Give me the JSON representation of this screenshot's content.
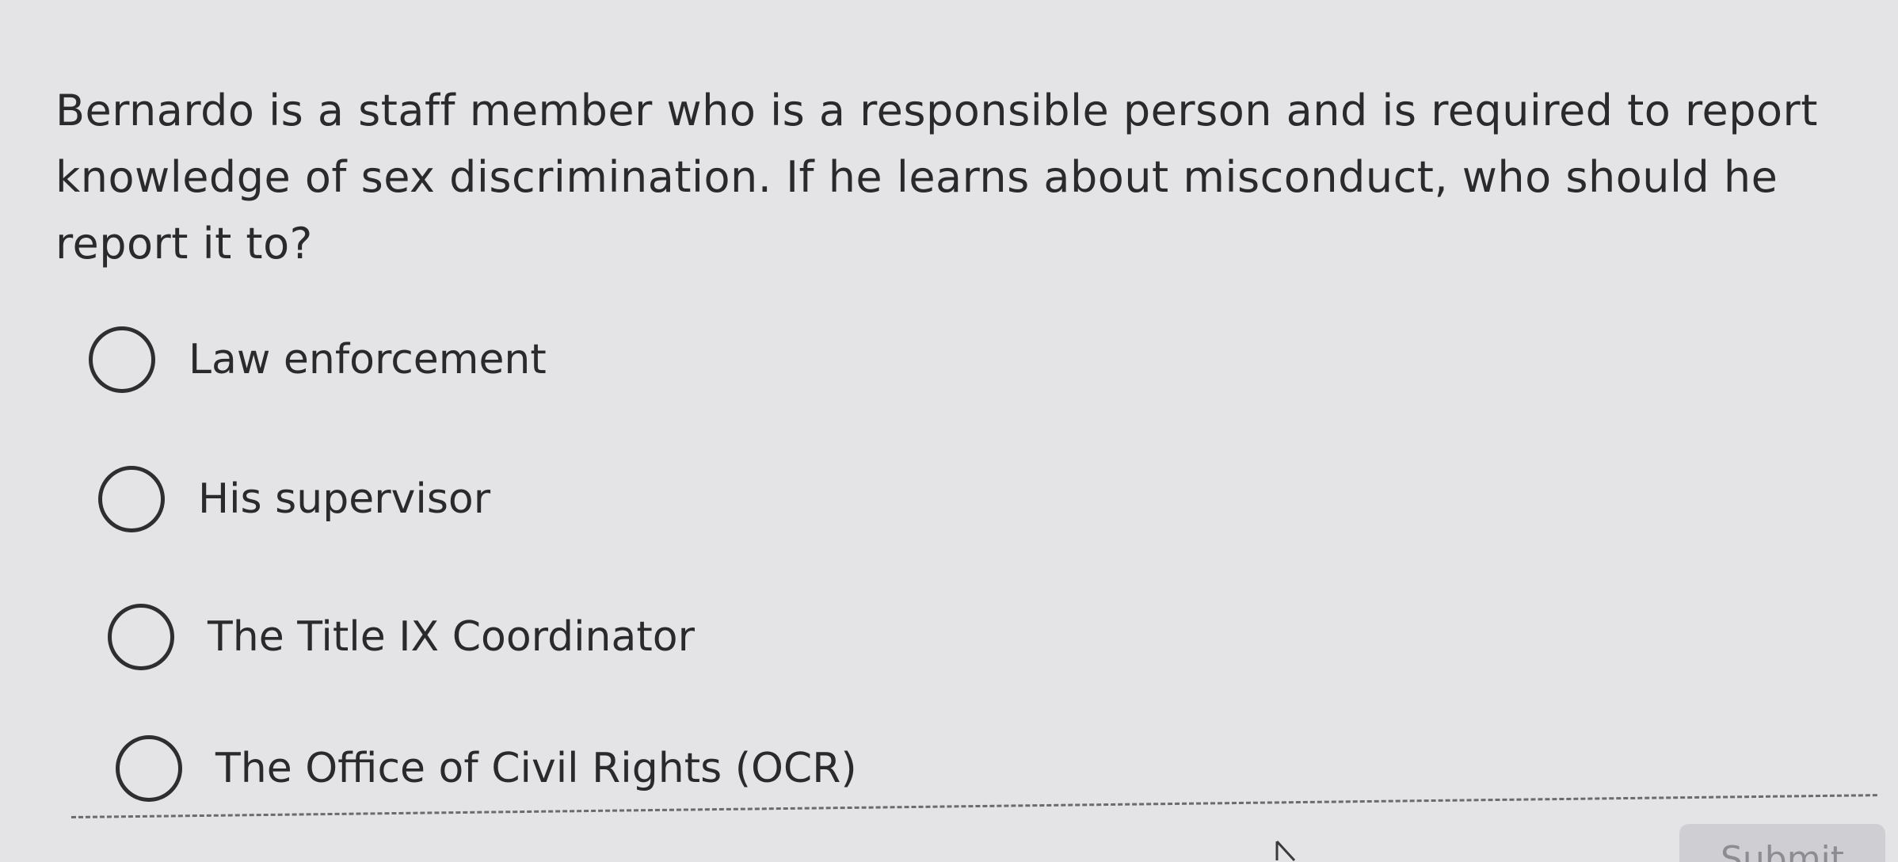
{
  "question": {
    "text": "Bernardo is a staff member who is a responsible person and is required to report knowledge of sex discrimination. If he learns about misconduct, who should he report it to?"
  },
  "options": [
    {
      "label": "Law enforcement"
    },
    {
      "label": "His supervisor"
    },
    {
      "label": "The Title IX Coordinator"
    },
    {
      "label": "The Office of Civil Rights (OCR)"
    }
  ],
  "footer": {
    "submit_label": "Submit"
  },
  "icons": {
    "cursor": "mouse-pointer-icon"
  },
  "colors": {
    "background": "#e4e4e6",
    "text": "#2a2a2c",
    "submit_bg": "#cfcfd3"
  }
}
